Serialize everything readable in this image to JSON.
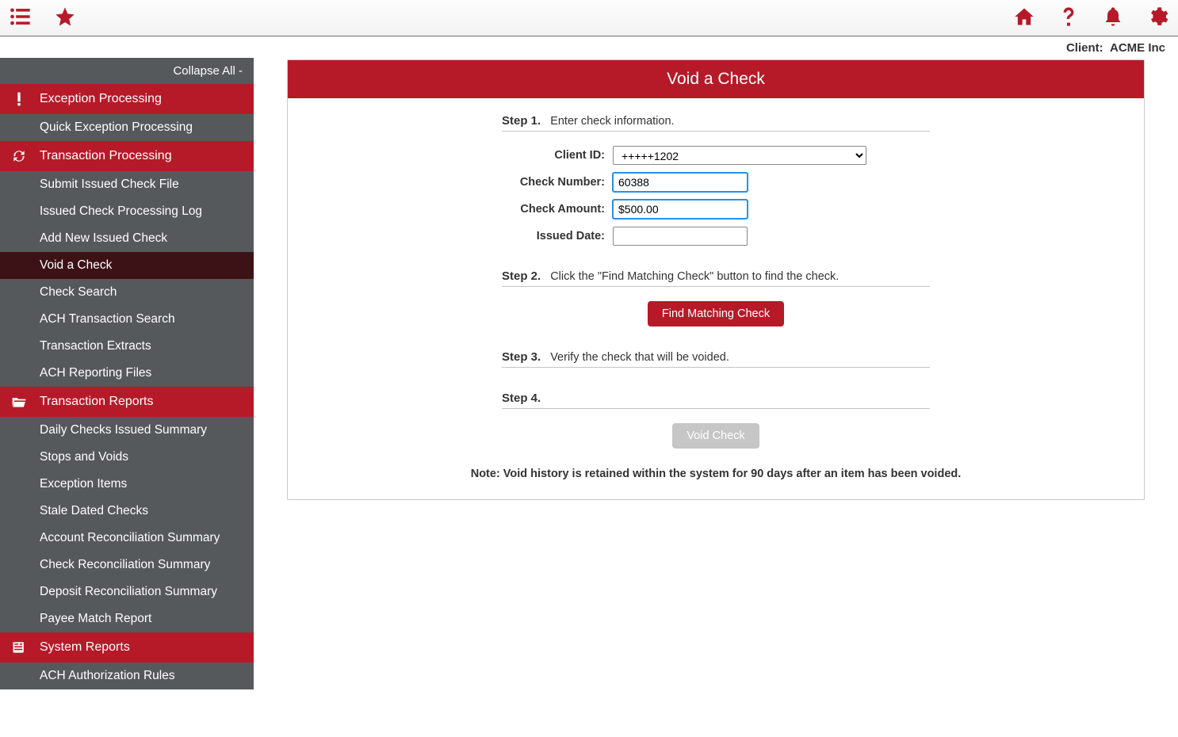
{
  "client_label": "Client:",
  "client_name": "ACME Inc",
  "collapse_all": "Collapse All -",
  "sidebar": {
    "groups": [
      {
        "label": "Exception Processing",
        "items": [
          {
            "label": "Quick Exception Processing"
          }
        ]
      },
      {
        "label": "Transaction Processing",
        "items": [
          {
            "label": "Submit Issued Check File"
          },
          {
            "label": "Issued Check Processing Log"
          },
          {
            "label": "Add New Issued Check"
          },
          {
            "label": "Void a Check",
            "active": true
          },
          {
            "label": "Check Search"
          },
          {
            "label": "ACH Transaction Search"
          },
          {
            "label": "Transaction Extracts"
          },
          {
            "label": "ACH Reporting Files"
          }
        ]
      },
      {
        "label": "Transaction Reports",
        "items": [
          {
            "label": "Daily Checks Issued Summary"
          },
          {
            "label": "Stops and Voids"
          },
          {
            "label": "Exception Items"
          },
          {
            "label": "Stale Dated Checks"
          },
          {
            "label": "Account Reconciliation Summary"
          },
          {
            "label": "Check Reconciliation Summary"
          },
          {
            "label": "Deposit Reconciliation Summary"
          },
          {
            "label": "Payee Match Report"
          }
        ]
      },
      {
        "label": "System Reports",
        "items": [
          {
            "label": "ACH Authorization Rules"
          }
        ]
      }
    ]
  },
  "page": {
    "title": "Void a Check",
    "step1_label": "Step 1.",
    "step1_text": "Enter check information.",
    "client_id_label": "Client ID:",
    "client_id_value": "+++++1202",
    "check_number_label": "Check Number:",
    "check_number_value": "60388",
    "check_amount_label": "Check Amount:",
    "check_amount_value": "$500.00",
    "issued_date_label": "Issued Date:",
    "issued_date_value": "",
    "step2_label": "Step 2.",
    "step2_text": "Click the \"Find Matching Check\" button to find the check.",
    "find_button": "Find Matching Check",
    "step3_label": "Step 3.",
    "step3_text": "Verify the check that will be voided.",
    "step4_label": "Step 4.",
    "void_button": "Void Check",
    "note": "Note: Void history is retained within the system for 90 days after an item has been voided."
  }
}
